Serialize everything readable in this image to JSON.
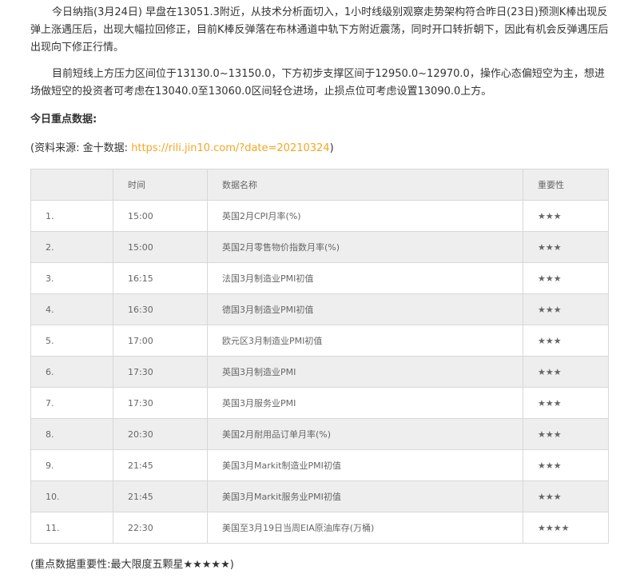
{
  "paragraphs": {
    "p1": "今日纳指(3月24日) 早盘在13051.3附近，从技术分析面切入，1小时线级别观察走势架构符合昨日(23日)预测K棒出现反弹上涨遇压后，出现大幅拉回修正，目前K棒反弹落在布林通道中轨下方附近震荡，同时开口转折朝下，因此有机会反弹遇压后出现向下修正行情。",
    "p2": "目前短线上方压力区间位于13130.0~13150.0，下方初步支撑区间于12950.0~12970.0，操作心态偏短空为主，想进场做短空的投资者可考虑在13040.0至13060.0区间轻仓进场，止损点位可考虑设置13090.0上方。"
  },
  "heading": "今日重点数据:",
  "source": {
    "prefix": "(资料来源: 金十数据: ",
    "link": "https://rili.jin10.com/?date=20210324",
    "suffix": ")"
  },
  "table": {
    "headers": [
      "",
      "时间",
      "数据名称",
      "重要性"
    ],
    "rows": [
      {
        "idx": "1.",
        "time": "15:00",
        "name": "英国2月CPI月率(%)",
        "stars": "★★★"
      },
      {
        "idx": "2.",
        "time": "15:00",
        "name": "英国2月零售物价指数月率(%)",
        "stars": "★★★"
      },
      {
        "idx": "3.",
        "time": "16:15",
        "name": "法国3月制造业PMI初值",
        "stars": "★★★"
      },
      {
        "idx": "4.",
        "time": "16:30",
        "name": "德国3月制造业PMI初值",
        "stars": "★★★"
      },
      {
        "idx": "5.",
        "time": "17:00",
        "name": "欧元区3月制造业PMI初值",
        "stars": "★★★"
      },
      {
        "idx": "6.",
        "time": "17:30",
        "name": "英国3月制造业PMI",
        "stars": "★★★"
      },
      {
        "idx": "7.",
        "time": "17:30",
        "name": "英国3月服务业PMI",
        "stars": "★★★"
      },
      {
        "idx": "8.",
        "time": "20:30",
        "name": "美国2月耐用品订单月率(%)",
        "stars": "★★★"
      },
      {
        "idx": "9.",
        "time": "21:45",
        "name": "美国3月Markit制造业PMI初值",
        "stars": "★★★"
      },
      {
        "idx": "10.",
        "time": "21:45",
        "name": "美国3月Markit服务业PMI初值",
        "stars": "★★★"
      },
      {
        "idx": "11.",
        "time": "22:30",
        "name": "美国至3月19日当周EIA原油库存(万桶)",
        "stars": "★★★★"
      }
    ]
  },
  "footer": "(重点数据重要性:最大限度五颗星★★★★★)",
  "colors": {
    "link": "#f5a623",
    "row_shade": "#eeeeee",
    "border": "#d8d8d8"
  }
}
